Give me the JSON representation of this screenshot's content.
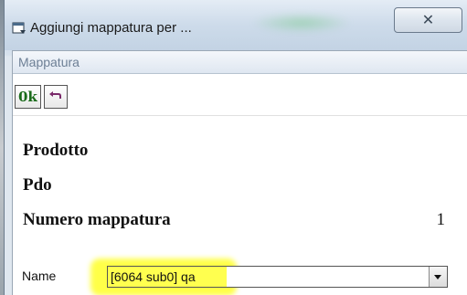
{
  "window": {
    "title": "Aggiungi mappatura per ...",
    "close_glyph": "✕"
  },
  "panel": {
    "header": "Mappatura"
  },
  "toolbar": {
    "ok_label": "0k",
    "undo_icon": "undo-icon"
  },
  "fields": [
    {
      "label": "Prodotto",
      "value": ""
    },
    {
      "label": "Pdo",
      "value": ""
    },
    {
      "label": "Numero mappatura",
      "value": "1"
    }
  ],
  "name_field": {
    "label": "Name",
    "value": "[6064 sub0] qa"
  },
  "colors": {
    "highlight": "#ffff28",
    "ok_text": "#1a6b1a",
    "header_text": "#6d7f95"
  }
}
